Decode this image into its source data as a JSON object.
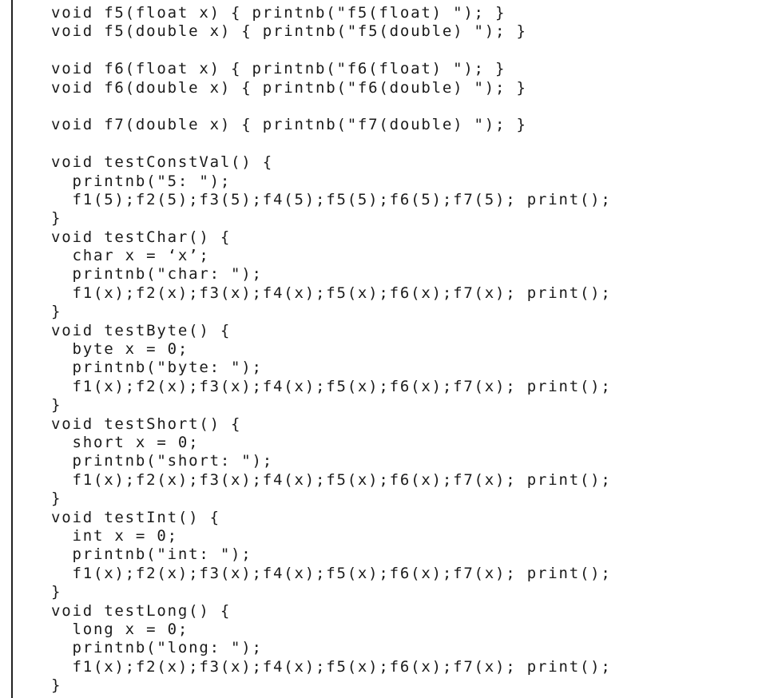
{
  "code": {
    "lines": [
      "void f5(float x) { printnb(\"f5(float) \"); }",
      "void f5(double x) { printnb(\"f5(double) \"); }",
      "",
      "void f6(float x) { printnb(\"f6(float) \"); }",
      "void f6(double x) { printnb(\"f6(double) \"); }",
      "",
      "void f7(double x) { printnb(\"f7(double) \"); }",
      "",
      "void testConstVal() {",
      "  printnb(\"5: \");",
      "  f1(5);f2(5);f3(5);f4(5);f5(5);f6(5);f7(5); print();",
      "}",
      "void testChar() {",
      "  char x = ‘x’;",
      "  printnb(\"char: \");",
      "  f1(x);f2(x);f3(x);f4(x);f5(x);f6(x);f7(x); print();",
      "}",
      "void testByte() {",
      "  byte x = 0;",
      "  printnb(\"byte: \");",
      "  f1(x);f2(x);f3(x);f4(x);f5(x);f6(x);f7(x); print();",
      "}",
      "void testShort() {",
      "  short x = 0;",
      "  printnb(\"short: \");",
      "  f1(x);f2(x);f3(x);f4(x);f5(x);f6(x);f7(x); print();",
      "}",
      "void testInt() {",
      "  int x = 0;",
      "  printnb(\"int: \");",
      "  f1(x);f2(x);f3(x);f4(x);f5(x);f6(x);f7(x); print();",
      "}",
      "void testLong() {",
      "  long x = 0;",
      "  printnb(\"long: \");",
      "  f1(x);f2(x);f3(x);f4(x);f5(x);f6(x);f7(x); print();",
      "}"
    ]
  }
}
